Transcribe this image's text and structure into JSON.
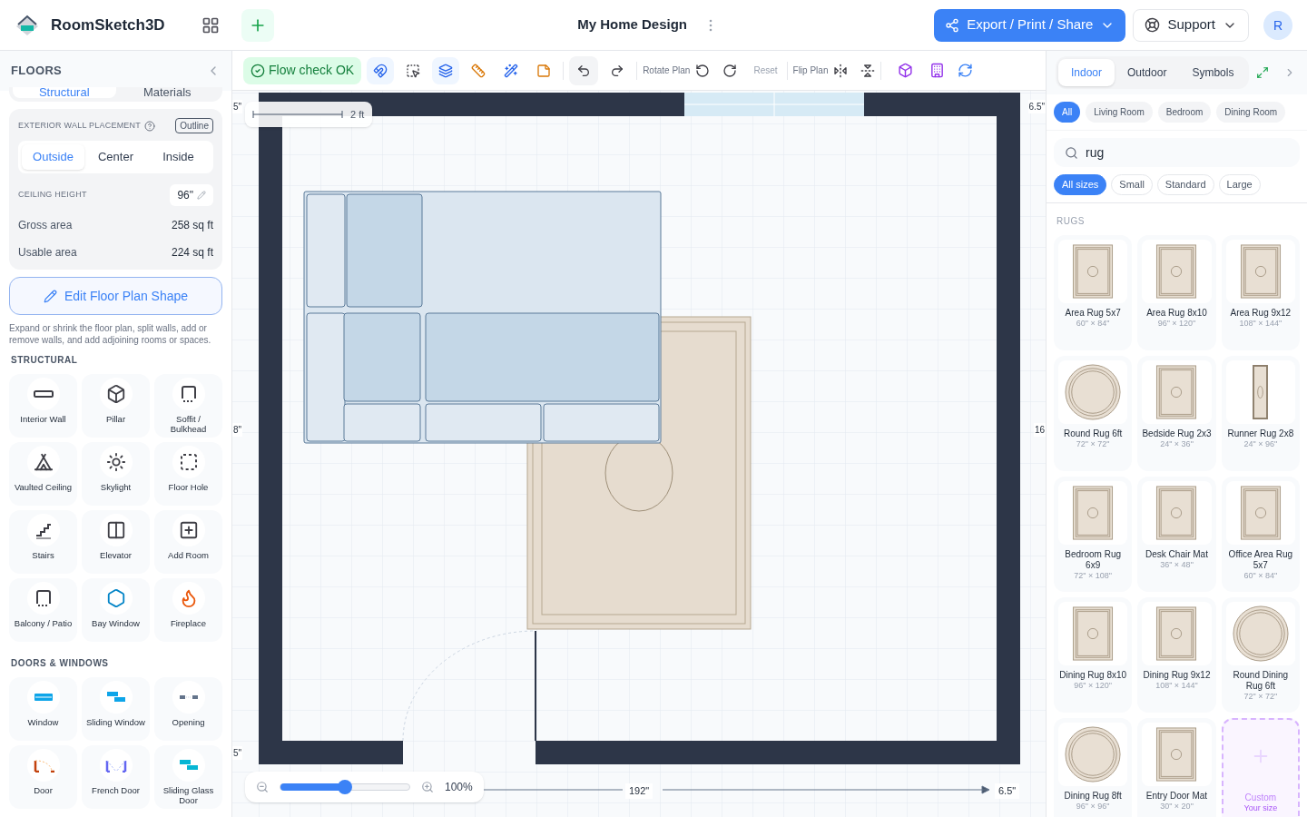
{
  "header": {
    "app_name": "RoomSketch3D",
    "title": "My Home Design",
    "export_label": "Export / Print / Share",
    "support_label": "Support",
    "avatar": "R"
  },
  "left": {
    "title": "FLOORS",
    "tabs": [
      {
        "label": "Structural",
        "selected": true
      },
      {
        "label": "Materials",
        "selected": false
      }
    ],
    "wall_placement": {
      "label": "EXTERIOR WALL PLACEMENT",
      "outline_label": "Outline",
      "options": [
        {
          "label": "Outside",
          "selected": true
        },
        {
          "label": "Center",
          "selected": false
        },
        {
          "label": "Inside",
          "selected": false
        }
      ]
    },
    "ceiling": {
      "label": "CEILING HEIGHT",
      "value": "96\""
    },
    "areas": [
      {
        "label": "Gross area",
        "value": "258 sq ft"
      },
      {
        "label": "Usable area",
        "value": "224 sq ft"
      }
    ],
    "edit_button": "Edit Floor Plan Shape",
    "help_text": "Expand or shrink the floor plan, split walls, add or remove walls, and add adjoining rooms or spaces.",
    "sections": [
      {
        "title": "STRUCTURAL",
        "items": [
          {
            "label": "Interior Wall"
          },
          {
            "label": "Pillar"
          },
          {
            "label": "Soffit / Bulkhead"
          },
          {
            "label": "Vaulted Ceiling"
          },
          {
            "label": "Skylight"
          },
          {
            "label": "Floor Hole"
          },
          {
            "label": "Stairs"
          },
          {
            "label": "Elevator"
          },
          {
            "label": "Add Room"
          },
          {
            "label": "Balcony / Patio"
          },
          {
            "label": "Bay Window"
          },
          {
            "label": "Fireplace"
          }
        ]
      },
      {
        "title": "DOORS & WINDOWS",
        "items": [
          {
            "label": "Window"
          },
          {
            "label": "Sliding Window"
          },
          {
            "label": "Opening"
          },
          {
            "label": "Door"
          },
          {
            "label": "French Door"
          },
          {
            "label": "Sliding Glass Door"
          }
        ]
      }
    ]
  },
  "toolbar": {
    "status": "Flow check OK",
    "tools": [
      {
        "active": true
      },
      {
        "active": false
      },
      {
        "active": true
      },
      {
        "active": false
      },
      {
        "active": false
      },
      {
        "active": false
      }
    ],
    "rotate_label": "Rotate Plan",
    "reset": {
      "label": "Reset",
      "disabled": true
    },
    "flip_label": "Flip Plan"
  },
  "canvas": {
    "scale_label": "2 ft",
    "dims": {
      "top_left": "5\"",
      "top_right": "6.5\"",
      "left_mid": "8\"",
      "right_mid": "16",
      "bottom_left": "5\"",
      "width": "192\"",
      "bottom_right": "6.5\""
    },
    "zoom": {
      "level": 0.5,
      "reading": "100%"
    }
  },
  "right": {
    "tabs": [
      {
        "label": "Indoor",
        "selected": true
      },
      {
        "label": "Outdoor",
        "selected": false
      },
      {
        "label": "Symbols",
        "selected": false
      }
    ],
    "categories": [
      {
        "label": "All",
        "selected": true
      },
      {
        "label": "Living Room",
        "selected": false
      },
      {
        "label": "Bedroom",
        "selected": false
      },
      {
        "label": "Dining Room",
        "selected": false
      }
    ],
    "search": {
      "value": "rug"
    },
    "sizes": [
      {
        "label": "All sizes",
        "selected": true
      },
      {
        "label": "Small",
        "selected": false
      },
      {
        "label": "Standard",
        "selected": false
      },
      {
        "label": "Large",
        "selected": false
      }
    ],
    "section_title": "RUGS",
    "items": [
      {
        "kind": "rect",
        "name": "Area Rug 5x7",
        "size": "60\" × 84\""
      },
      {
        "kind": "rect",
        "name": "Area Rug 8x10",
        "size": "96\" × 120\""
      },
      {
        "kind": "rect",
        "name": "Area Rug 9x12",
        "size": "108\" × 144\""
      },
      {
        "kind": "round",
        "name": "Round Rug 6ft",
        "size": "72\" × 72\""
      },
      {
        "kind": "rect",
        "name": "Bedside Rug 2x3",
        "size": "24\" × 36\""
      },
      {
        "kind": "runner",
        "name": "Runner Rug 2x8",
        "size": "24\" × 96\""
      },
      {
        "kind": "rect",
        "name": "Bedroom Rug 6x9",
        "size": "72\" × 108\""
      },
      {
        "kind": "rect",
        "name": "Desk Chair Mat",
        "size": "36\" × 48\""
      },
      {
        "kind": "rect",
        "name": "Office Area Rug 5x7",
        "size": "60\" × 84\""
      },
      {
        "kind": "rect",
        "name": "Dining Rug 8x10",
        "size": "96\" × 120\""
      },
      {
        "kind": "rect",
        "name": "Dining Rug 9x12",
        "size": "108\" × 144\""
      },
      {
        "kind": "round",
        "name": "Round Dining Rug 6ft",
        "size": "72\" × 72\""
      },
      {
        "kind": "round",
        "name": "Dining Rug 8ft",
        "size": "96\" × 96\""
      },
      {
        "kind": "rect",
        "name": "Entry Door Mat",
        "size": "30\" × 20\""
      },
      {
        "kind": "custom",
        "name": "Custom",
        "size": "Your size"
      }
    ]
  }
}
